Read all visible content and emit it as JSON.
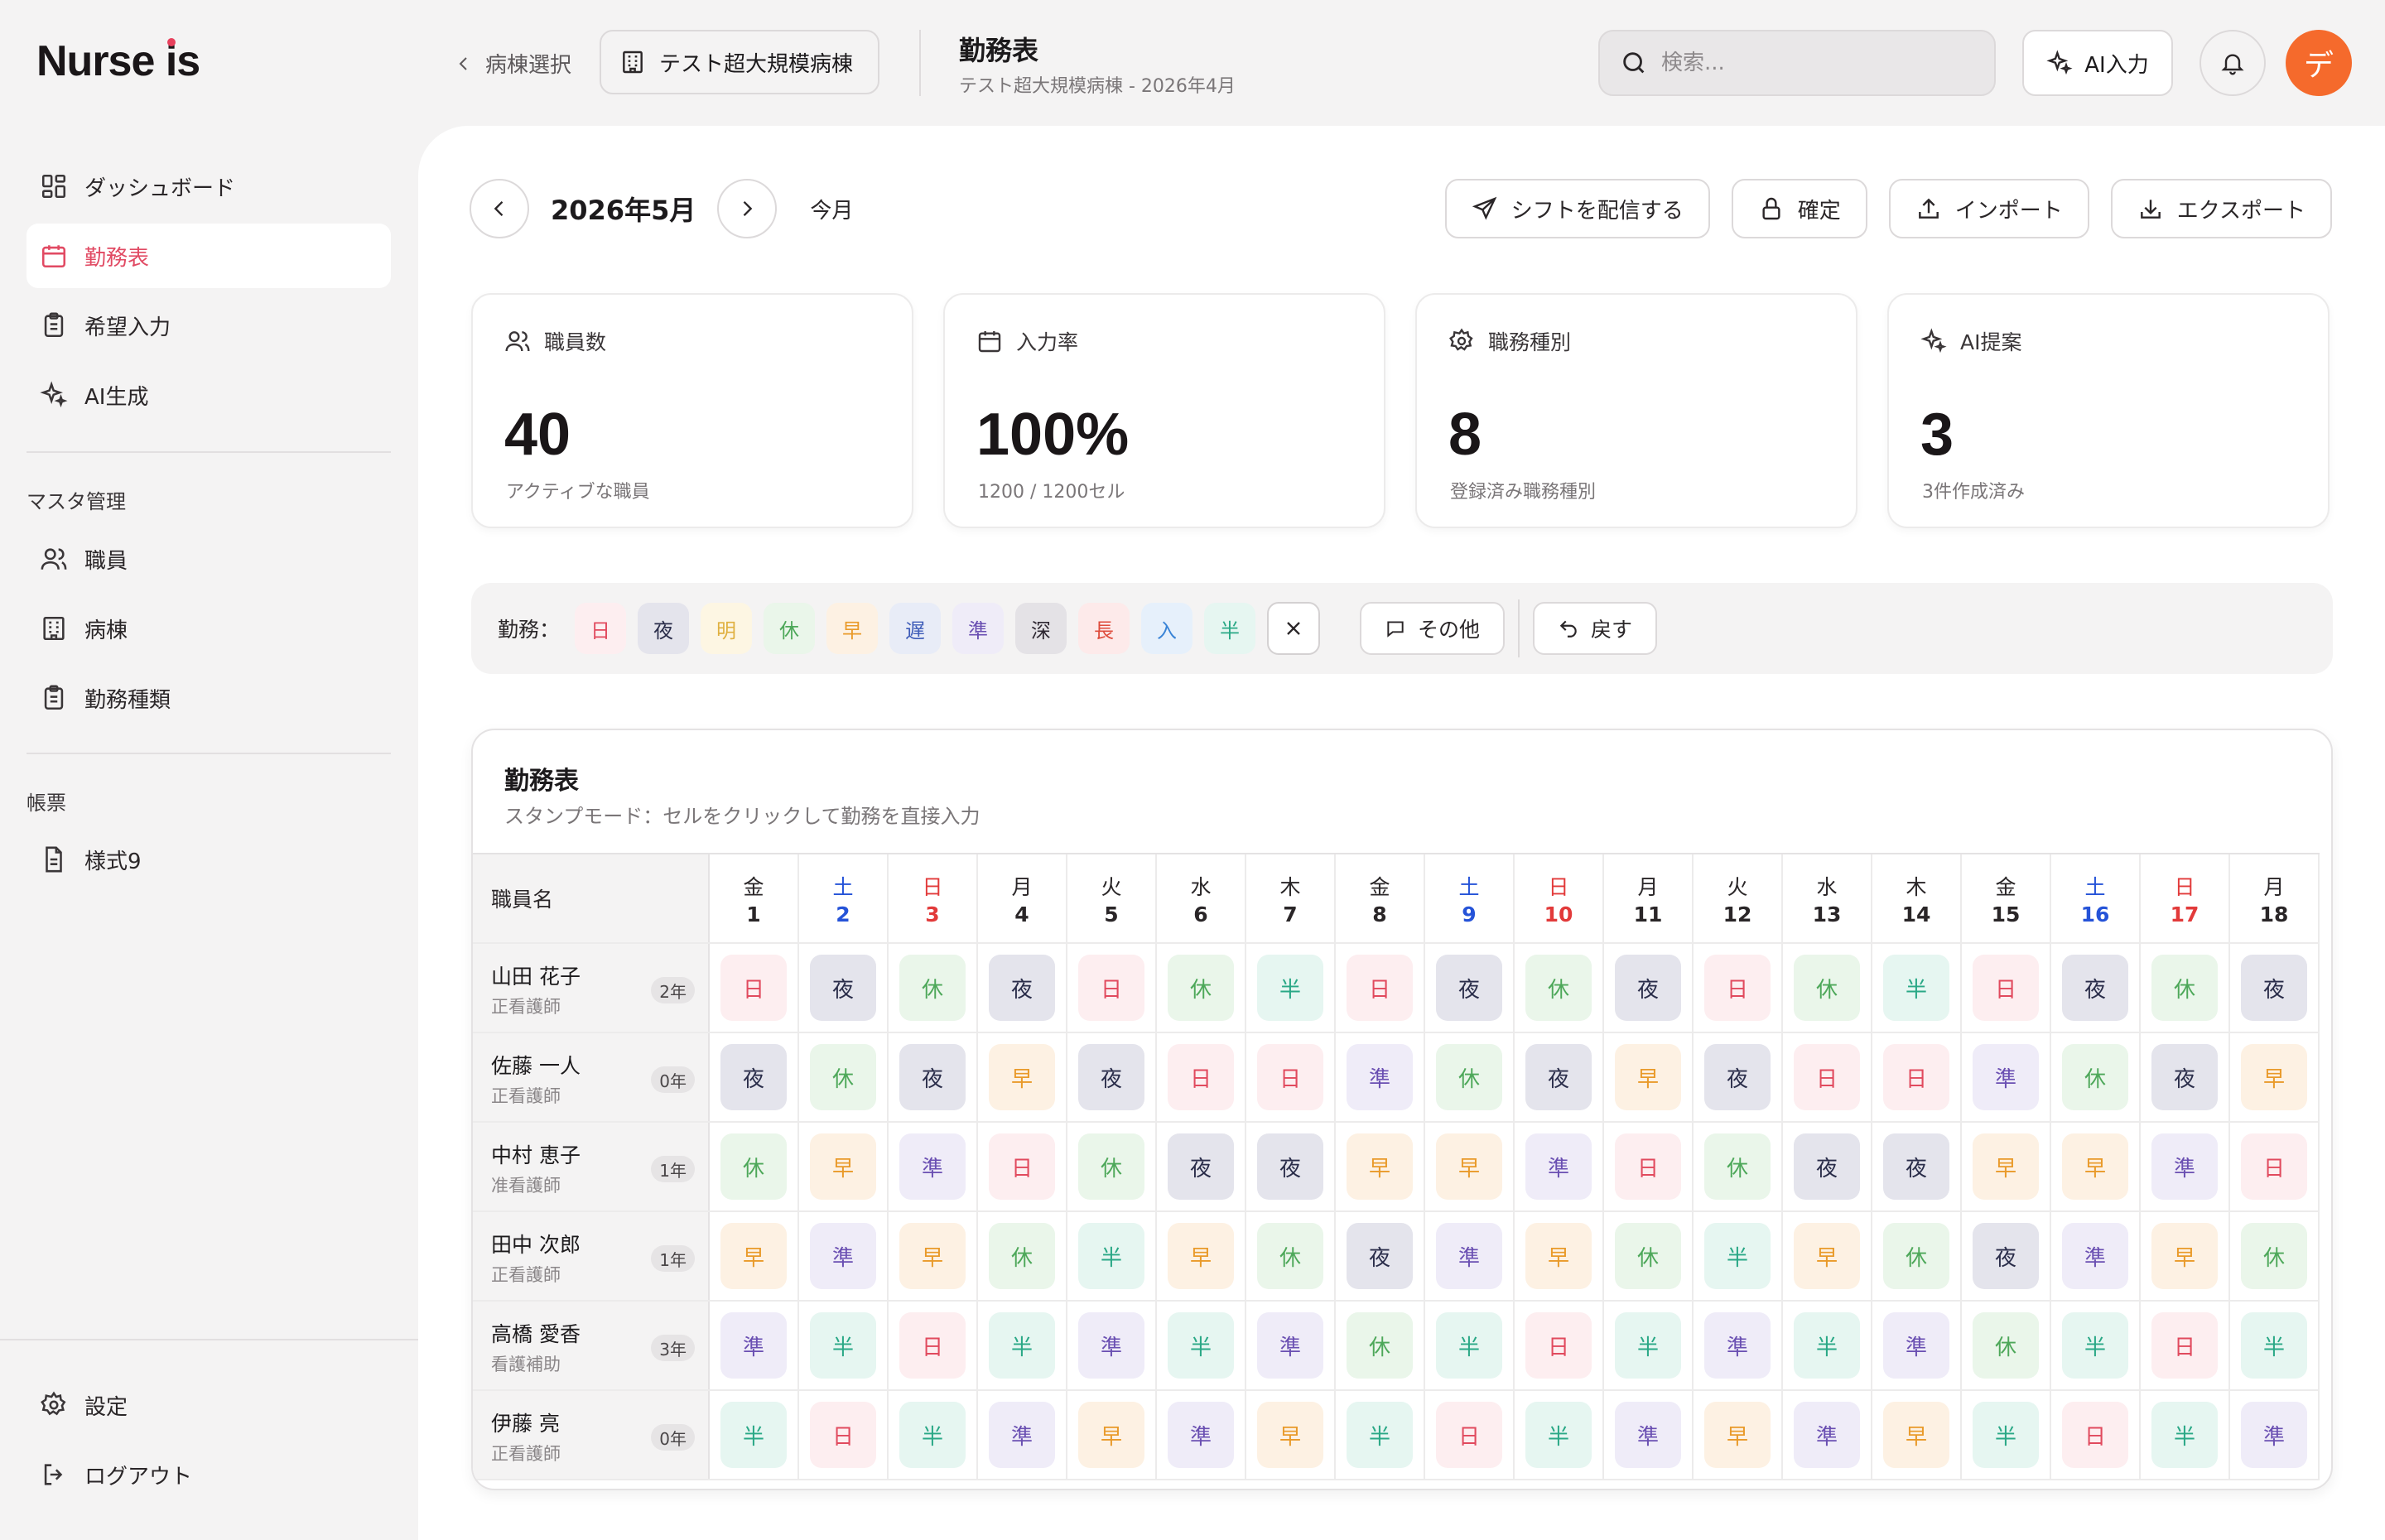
{
  "app": {
    "logo_text_a": "Nurse ",
    "logo_text_i": "i",
    "logo_text_b": "s"
  },
  "sidebar": {
    "main_items": [
      {
        "label": "ダッシュボード",
        "icon": "dashboard-icon"
      },
      {
        "label": "勤務表",
        "icon": "calendar-icon",
        "active": true
      },
      {
        "label": "希望入力",
        "icon": "clipboard-icon"
      },
      {
        "label": "AI生成",
        "icon": "sparkles-icon"
      }
    ],
    "master_section": "マスタ管理",
    "master_items": [
      {
        "label": "職員",
        "icon": "users-icon"
      },
      {
        "label": "病棟",
        "icon": "building-icon"
      },
      {
        "label": "勤務種類",
        "icon": "clipboard-icon"
      }
    ],
    "report_section": "帳票",
    "report_items": [
      {
        "label": "様式9",
        "icon": "document-icon"
      }
    ],
    "settings_label": "設定",
    "logout_label": "ログアウト"
  },
  "header": {
    "back_label": "病棟選択",
    "ward_button": "テスト超大規模病棟",
    "title": "勤務表",
    "subtitle": "テスト超大規模病棟 - 2026年4月",
    "search_placeholder": "検索...",
    "ai_button": "AI入力",
    "avatar_initial": "デ"
  },
  "toolbar": {
    "month": "2026年5月",
    "today": "今月",
    "publish": "シフトを配信する",
    "confirm": "確定",
    "import": "インポート",
    "export": "エクスポート"
  },
  "stats": [
    {
      "label": "職員数",
      "icon": "users-icon",
      "value": "40",
      "sub": "アクティブな職員"
    },
    {
      "label": "入力率",
      "icon": "calendar-icon",
      "value": "100%",
      "sub": "1200 / 1200セル"
    },
    {
      "label": "職務種別",
      "icon": "gear-icon",
      "value": "8",
      "sub": "登録済み職務種別"
    },
    {
      "label": "AI提案",
      "icon": "sparkles-icon",
      "value": "3",
      "sub": "3件作成済み"
    }
  ],
  "stamp_bar": {
    "label": "勤務：",
    "stamps": [
      "日",
      "夜",
      "明",
      "休",
      "早",
      "遅",
      "準",
      "深",
      "長",
      "入",
      "半"
    ],
    "other": "その他",
    "undo": "戻す"
  },
  "roster": {
    "title": "勤務表",
    "subtitle": "スタンプモード：セルをクリックして勤務を直接入力",
    "name_header": "職員名",
    "days": [
      {
        "dow": "金",
        "d": "1",
        "type": ""
      },
      {
        "dow": "土",
        "d": "2",
        "type": "sat"
      },
      {
        "dow": "日",
        "d": "3",
        "type": "sun"
      },
      {
        "dow": "月",
        "d": "4",
        "type": ""
      },
      {
        "dow": "火",
        "d": "5",
        "type": ""
      },
      {
        "dow": "水",
        "d": "6",
        "type": ""
      },
      {
        "dow": "木",
        "d": "7",
        "type": ""
      },
      {
        "dow": "金",
        "d": "8",
        "type": ""
      },
      {
        "dow": "土",
        "d": "9",
        "type": "sat"
      },
      {
        "dow": "日",
        "d": "10",
        "type": "sun"
      },
      {
        "dow": "月",
        "d": "11",
        "type": ""
      },
      {
        "dow": "火",
        "d": "12",
        "type": ""
      },
      {
        "dow": "水",
        "d": "13",
        "type": ""
      },
      {
        "dow": "木",
        "d": "14",
        "type": ""
      },
      {
        "dow": "金",
        "d": "15",
        "type": ""
      },
      {
        "dow": "土",
        "d": "16",
        "type": "sat"
      },
      {
        "dow": "日",
        "d": "17",
        "type": "sun"
      },
      {
        "dow": "月",
        "d": "18",
        "type": ""
      }
    ],
    "staff": [
      {
        "name": "山田 花子",
        "role": "正看護師",
        "years": "2年",
        "shifts": [
          "日",
          "夜",
          "休",
          "夜",
          "日",
          "休",
          "半",
          "日",
          "夜",
          "休",
          "夜",
          "日",
          "休",
          "半",
          "日",
          "夜",
          "休",
          "夜"
        ]
      },
      {
        "name": "佐藤 一人",
        "role": "正看護師",
        "years": "0年",
        "shifts": [
          "夜",
          "休",
          "夜",
          "早",
          "夜",
          "日",
          "日",
          "準",
          "休",
          "夜",
          "早",
          "夜",
          "日",
          "日",
          "準",
          "休",
          "夜",
          "早"
        ]
      },
      {
        "name": "中村 恵子",
        "role": "准看護師",
        "years": "1年",
        "shifts": [
          "休",
          "早",
          "準",
          "日",
          "休",
          "夜",
          "夜",
          "早",
          "早",
          "準",
          "日",
          "休",
          "夜",
          "夜",
          "早",
          "早",
          "準",
          "日"
        ]
      },
      {
        "name": "田中 次郎",
        "role": "正看護師",
        "years": "1年",
        "shifts": [
          "早",
          "準",
          "早",
          "休",
          "半",
          "早",
          "休",
          "夜",
          "準",
          "早",
          "休",
          "半",
          "早",
          "休",
          "夜",
          "準",
          "早",
          "休"
        ]
      },
      {
        "name": "高橋 愛香",
        "role": "看護補助",
        "years": "3年",
        "shifts": [
          "準",
          "半",
          "日",
          "半",
          "準",
          "半",
          "準",
          "休",
          "半",
          "日",
          "半",
          "準",
          "半",
          "準",
          "休",
          "半",
          "日",
          "半"
        ]
      },
      {
        "name": "伊藤 亮",
        "role": "正看護師",
        "years": "0年",
        "shifts": [
          "半",
          "日",
          "半",
          "準",
          "早",
          "準",
          "早",
          "半",
          "日",
          "半",
          "準",
          "早",
          "準",
          "早",
          "半",
          "日",
          "半",
          "準"
        ]
      }
    ]
  }
}
